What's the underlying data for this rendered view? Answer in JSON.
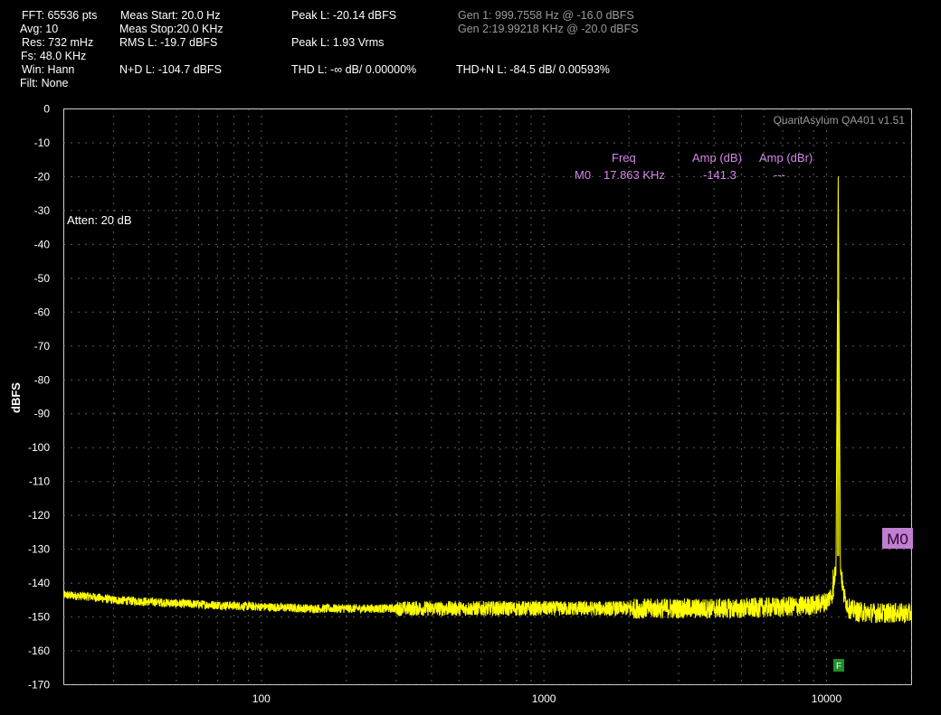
{
  "stats": {
    "fft": "FFT: 65536 pts",
    "avg": "Avg: 10",
    "res": "Res: 732 mHz",
    "fs": "Fs: 48.0 KHz",
    "win": "Win: Hann",
    "filt": "Filt: None",
    "meas_start": "Meas Start: 20.0 Hz",
    "meas_stop": "Meas Stop:20.0 KHz",
    "rms": "RMS L: -19.7 dBFS",
    "nd": "N+D L: -104.7 dBFS",
    "peak_dbfs": "Peak L: -20.14 dBFS",
    "peak_vrms": "Peak L: 1.93 Vrms",
    "thd": "THD L: -∞ dB/ 0.00000%",
    "gen1": "Gen 1: 999.7558 Hz @ -16.0  dBFS",
    "gen2": "Gen 2:19.99218 KHz @ -20.0  dBFS",
    "thdn": "THD+N L: -84.5 dB/ 0.00593%"
  },
  "brand": "QuantAsylum QA401 v1.51",
  "atten": "Atten: 20 dB",
  "marker_table": {
    "h_freq": "Freq",
    "h_amp_db": "Amp (dB)",
    "h_amp_dbr": "Amp (dBr)",
    "row_name": "M0",
    "row_freq": "17.863 KHz",
    "row_amp_db": "-141.3",
    "row_amp_dbr": "---"
  },
  "marker_tag": "M0",
  "f_tag": "F",
  "colors": {
    "trace": "#ffff00",
    "marker": "#d488e8",
    "marker_tag_bg": "#c07fd0",
    "f_tag_bg": "#1f8f2a",
    "grid": "#9a9a9a"
  },
  "chart_data": {
    "type": "line",
    "ylabel": "dBFS",
    "xlabel": "",
    "xscale": "log",
    "xlim": [
      20,
      20000
    ],
    "ylim": [
      -170,
      0
    ],
    "yticks": [
      0,
      -10,
      -20,
      -30,
      -40,
      -50,
      -60,
      -70,
      -80,
      -90,
      -100,
      -110,
      -120,
      -130,
      -140,
      -150,
      -160,
      -170
    ],
    "xticks": [
      100,
      1000,
      10000
    ],
    "xtick_labels": [
      "100",
      "1000",
      "10000"
    ],
    "grid": true,
    "series": [
      {
        "x": [
          20,
          25,
          30,
          40,
          50,
          70,
          100,
          150,
          200,
          300,
          500,
          700,
          1000,
          1500,
          2000,
          3000,
          4000,
          5000,
          6000,
          7000,
          8000,
          9000,
          10000,
          10500,
          10800,
          11000,
          11200,
          11500,
          12000,
          13000,
          15000,
          17863,
          20000
        ],
        "y": [
          -143.5,
          -144,
          -145,
          -145.5,
          -146,
          -146.5,
          -147,
          -147.5,
          -147.5,
          -147.5,
          -147.5,
          -147.5,
          -147.5,
          -147.5,
          -147.5,
          -147.5,
          -147.5,
          -147.5,
          -147.2,
          -147,
          -146.8,
          -146.5,
          -145.5,
          -143,
          -135,
          -20,
          -135,
          -143.5,
          -147.5,
          -148.5,
          -148.8,
          -148.8,
          -149
        ]
      }
    ]
  }
}
